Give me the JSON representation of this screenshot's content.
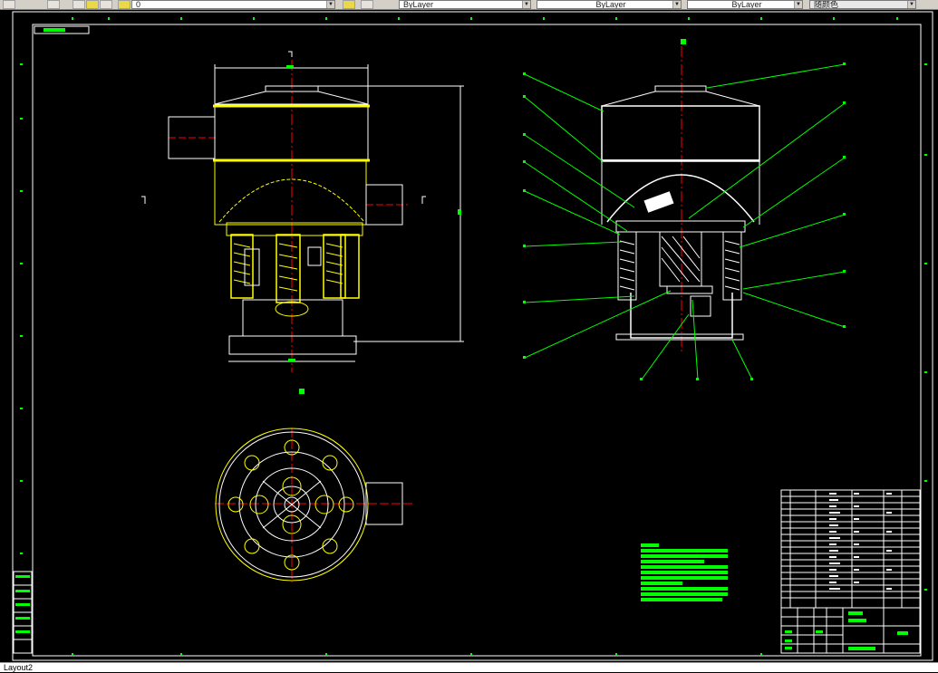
{
  "toolbar": {
    "layer_value": "0",
    "color_combo": "ByLayer",
    "linetype_combo": "ByLayer",
    "lineweight_combo": "ByLayer",
    "plotstyle_combo": "随颜色"
  },
  "layout_tab": {
    "label": "Layout2"
  },
  "colors": {
    "background": "#000000",
    "frame": "#ffffff",
    "geometry": "#ffffff",
    "highlight": "#ffff00",
    "leader": "#00ff00",
    "center": "#ff0000",
    "text_block": "#00ff00"
  },
  "icons": [
    "layer-icon",
    "lightbulb-icon",
    "sun-icon",
    "lock-icon",
    "color-icon",
    "layer-props-icon"
  ]
}
